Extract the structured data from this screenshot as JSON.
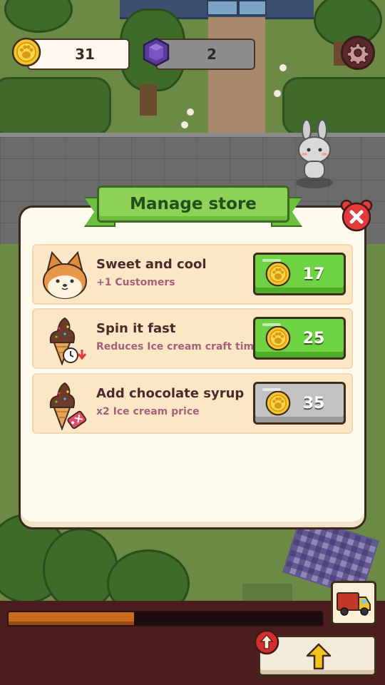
{
  "hud": {
    "coins": "31",
    "gems": "2"
  },
  "modal": {
    "title": "Manage store",
    "upgrades": [
      {
        "title": "Sweet and cool",
        "subtitle": "+1 Customers",
        "price": "17",
        "affordable": true,
        "icon": "shiba-dog-icon"
      },
      {
        "title": "Spin it fast",
        "subtitle": "Reduces Ice cream craft time",
        "price": "25",
        "affordable": true,
        "icon": "ice-cream-timer-icon"
      },
      {
        "title": "Add chocolate syrup",
        "subtitle": "x2 Ice cream price",
        "price": "35",
        "affordable": false,
        "icon": "ice-cream-price-tag-icon"
      }
    ]
  },
  "progress": {
    "fraction": 0.4
  },
  "colors": {
    "accent_green": "#6ed340",
    "disabled_gray": "#c2c2c2",
    "close_red": "#e03a3a",
    "progress_orange": "#c96a1e"
  }
}
